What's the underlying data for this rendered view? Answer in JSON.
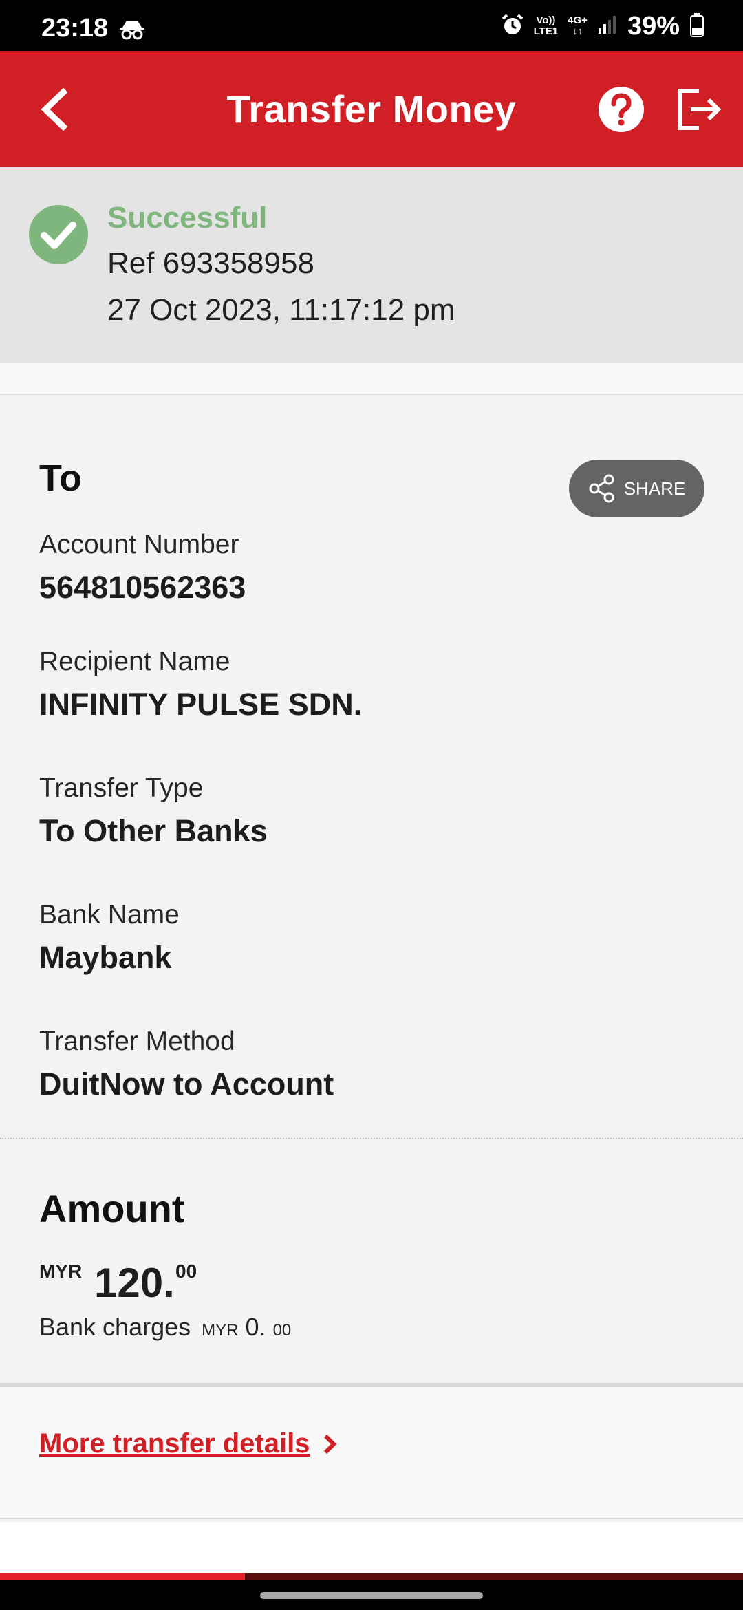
{
  "status_bar": {
    "time": "23:18",
    "network_volte": "Vo))",
    "network_lte": "LTE1",
    "network_4g": "4G+",
    "battery": "39%",
    "icons": [
      "incognito-icon",
      "alarm-icon",
      "signal-icon",
      "battery-icon"
    ]
  },
  "app_bar": {
    "title": "Transfer Money",
    "icons": [
      "back-icon",
      "help-icon",
      "logout-icon"
    ],
    "color": "#d11f26"
  },
  "transaction": {
    "status": "Successful",
    "status_color": "#7fb67e",
    "reference": "Ref 693358958",
    "datetime": "27 Oct 2023, 11:17:12 pm"
  },
  "recipient": {
    "heading": "To",
    "share_label": "SHARE",
    "fields": [
      {
        "label": "Account Number",
        "value": "564810562363"
      },
      {
        "label": "Recipient Name",
        "value": "INFINITY PULSE SDN."
      },
      {
        "label": "Transfer Type",
        "value": "To Other Banks"
      },
      {
        "label": "Bank Name",
        "value": "Maybank"
      },
      {
        "label": "Transfer Method",
        "value": "DuitNow to Account"
      }
    ]
  },
  "amount": {
    "heading": "Amount",
    "currency": "MYR",
    "integer": "120.",
    "decimal": "00",
    "charges_label": "Bank charges",
    "charges_currency": "MYR",
    "charges_integer": "0.",
    "charges_decimal": "00"
  },
  "links": {
    "more_details": "More transfer details"
  },
  "progress": {
    "fraction": 0.33
  }
}
